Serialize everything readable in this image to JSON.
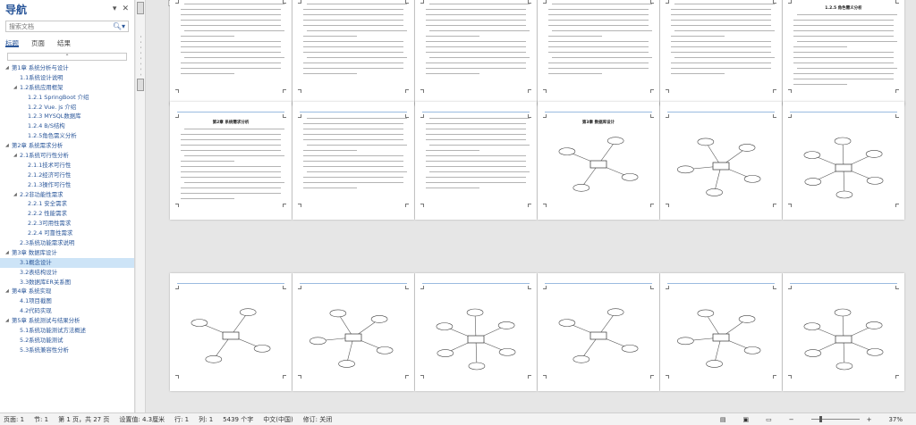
{
  "nav": {
    "title": "导航",
    "search_placeholder": "搜索文档",
    "tabs": [
      "标题",
      "页面",
      "结果"
    ],
    "items": [
      {
        "text": "第1章 系统分析与设计",
        "level": 0,
        "expanded": true
      },
      {
        "text": "1.1系统设计说明",
        "level": 1
      },
      {
        "text": "1.2系统应用框架",
        "level": 1,
        "expanded": true
      },
      {
        "text": "1.2.1 SpringBoot 介绍",
        "level": 2
      },
      {
        "text": "1.2.2 Vue. js 介绍",
        "level": 2
      },
      {
        "text": "1.2.3 MYSQL数据库",
        "level": 2
      },
      {
        "text": "1.2.4 B/S结构",
        "level": 2
      },
      {
        "text": "1.2.5角色需义分析",
        "level": 2
      },
      {
        "text": "第2章 系统需求分析",
        "level": 0,
        "expanded": true
      },
      {
        "text": "2.1系统可行性分析",
        "level": 1,
        "expanded": true
      },
      {
        "text": "2.1.1技术可行性",
        "level": 2
      },
      {
        "text": "2.1.2经济可行性",
        "level": 2
      },
      {
        "text": "2.1.3操作可行性",
        "level": 2
      },
      {
        "text": "2.2非功能性需求",
        "level": 1,
        "expanded": true
      },
      {
        "text": "2.2.1 安全需求",
        "level": 2
      },
      {
        "text": "2.2.2 性能需求",
        "level": 2
      },
      {
        "text": "2.2.3可用性需求",
        "level": 2
      },
      {
        "text": "2.2.4 可靠性需求",
        "level": 2
      },
      {
        "text": "2.3系统功能需求说明",
        "level": 1
      },
      {
        "text": "第3章 数据库设计",
        "level": 0,
        "expanded": true
      },
      {
        "text": "3.1概念设计",
        "level": 1,
        "selected": true
      },
      {
        "text": "3.2表结构设计",
        "level": 1
      },
      {
        "text": "3.3数据库ER关系图",
        "level": 1
      },
      {
        "text": "第4章 系统实现",
        "level": 0,
        "expanded": true
      },
      {
        "text": "4.1项目截图",
        "level": 1
      },
      {
        "text": "4.2代码实现",
        "level": 1
      },
      {
        "text": "第5章 系统测试与结果分析",
        "level": 0,
        "expanded": true
      },
      {
        "text": "5.1系统功能测试方法概述",
        "level": 1
      },
      {
        "text": "5.2系统功能测试",
        "level": 1
      },
      {
        "text": "5.3系统兼容性分析",
        "level": 1
      }
    ]
  },
  "ruler": {
    "ticks": [
      "4",
      "8",
      "10",
      "18",
      "20",
      "24",
      "28",
      "32",
      "36",
      "42",
      "40",
      "38"
    ]
  },
  "pages": [
    {
      "title": "",
      "kind": "text"
    },
    {
      "title": "",
      "kind": "toc"
    },
    {
      "title": "",
      "kind": "text"
    },
    {
      "title": "",
      "kind": "text"
    },
    {
      "title": "",
      "kind": "text"
    },
    {
      "title": "1.2.5 角色需义分析",
      "kind": "text"
    },
    {
      "title": "第2章 系统需求分析",
      "kind": "text"
    },
    {
      "title": "",
      "kind": "text"
    },
    {
      "title": "",
      "kind": "text"
    },
    {
      "title": "第3章 数据库设计",
      "kind": "diagram"
    },
    {
      "title": "",
      "kind": "diagram"
    },
    {
      "title": "",
      "kind": "diagram"
    },
    {
      "title": "",
      "kind": "diagram"
    },
    {
      "title": "",
      "kind": "diagram"
    },
    {
      "title": "",
      "kind": "diagram"
    },
    {
      "title": "",
      "kind": "diagram"
    },
    {
      "title": "",
      "kind": "diagram"
    },
    {
      "title": "",
      "kind": "diagram"
    }
  ],
  "status": {
    "page": "页面: 1",
    "section": "节: 1",
    "page_of": "第 1 页，共 27 页",
    "position": "设置值: 4.3厘米",
    "row": "行: 1",
    "col": "列: 1",
    "words": "5439 个字",
    "language": "中文(中国)",
    "revisions": "修订: 关闭",
    "zoom": "37%",
    "zoom_level": 0.37
  }
}
